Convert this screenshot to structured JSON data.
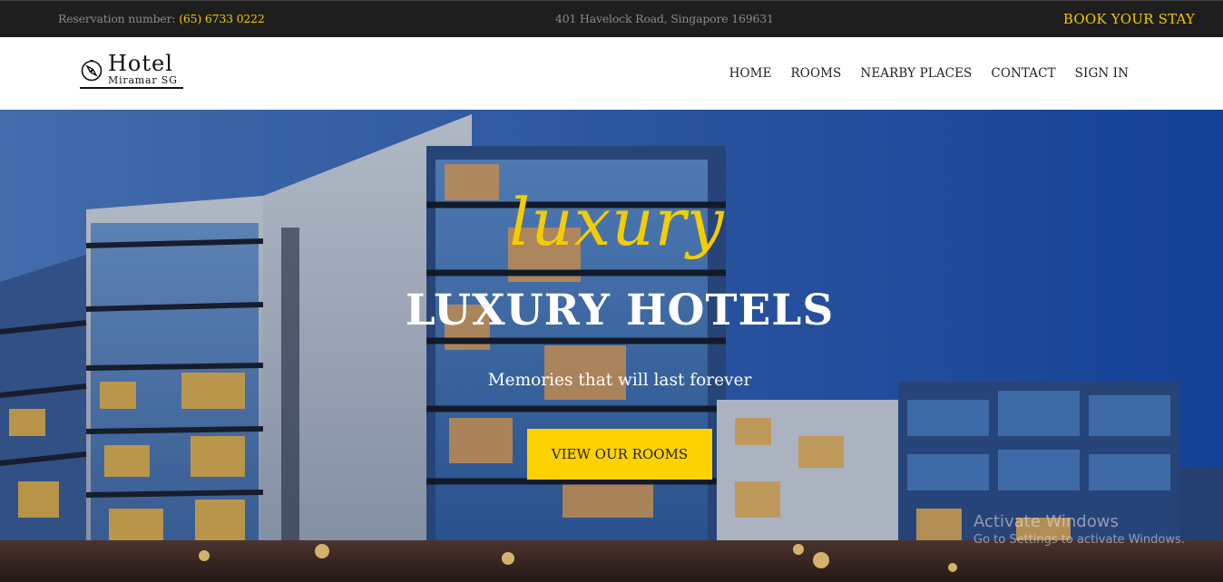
{
  "topbar": {
    "reservation_label": "Reservation number:",
    "reservation_number": "(65) 6733 0222",
    "address": "401 Havelock Road, Singapore 169631",
    "book_label": "BOOK YOUR STAY"
  },
  "logo": {
    "title": "Hotel",
    "subtitle": "Miramar SG",
    "icon": "compass-icon"
  },
  "nav": {
    "items": [
      "HOME",
      "ROOMS",
      "NEARBY PLACES",
      "CONTACT",
      "SIGN IN"
    ]
  },
  "hero": {
    "script_text": "luxury",
    "headline": "LUXURY HOTELS",
    "tagline": "Memories that will last forever",
    "cta_label": "VIEW OUR ROOMS"
  },
  "watermark": {
    "title": "Activate Windows",
    "subtitle": "Go to Settings to activate Windows."
  },
  "colors": {
    "accent": "#fcd200",
    "topbar_bg": "#1e1e1e",
    "hero_sky": "#2f5fb4"
  }
}
